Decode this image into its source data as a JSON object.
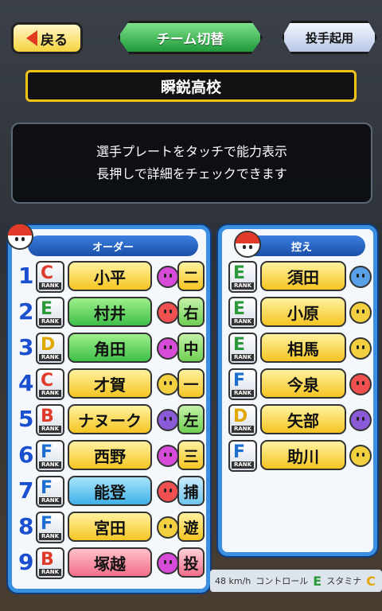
{
  "top_bar": {
    "back_label": "戻る",
    "team_switch_label": "チーム切替",
    "pitcher_label": "投手起用"
  },
  "school_name": "瞬鋭高校",
  "info": {
    "line1": "選手プレートをタッチで能力表示",
    "line2": "長押しで詳細をチェックできます"
  },
  "order_panel": {
    "title": "オーダー",
    "players": [
      {
        "num": "1",
        "rank": "C",
        "name": "小平",
        "pos": "二",
        "mood": "best"
      },
      {
        "num": "2",
        "rank": "E",
        "name": "村井",
        "pos": "右",
        "mood": "good"
      },
      {
        "num": "3",
        "rank": "D",
        "name": "角田",
        "pos": "中",
        "mood": "best"
      },
      {
        "num": "4",
        "rank": "C",
        "name": "才賀",
        "pos": "一",
        "mood": "normal"
      },
      {
        "num": "5",
        "rank": "B",
        "name": "ナヌーク",
        "pos": "左",
        "mood": "bad"
      },
      {
        "num": "6",
        "rank": "F",
        "name": "西野",
        "pos": "三",
        "mood": "best"
      },
      {
        "num": "7",
        "rank": "F",
        "name": "能登",
        "pos": "捕",
        "mood": "good"
      },
      {
        "num": "8",
        "rank": "F",
        "name": "宮田",
        "pos": "遊",
        "mood": "normal"
      },
      {
        "num": "9",
        "rank": "B",
        "name": "塚越",
        "pos": "投",
        "mood": "best"
      }
    ]
  },
  "bench_panel": {
    "title": "控え",
    "players": [
      {
        "rank": "E",
        "name": "須田",
        "mood": "worst"
      },
      {
        "rank": "E",
        "name": "小原",
        "mood": "normal"
      },
      {
        "rank": "E",
        "name": "相馬",
        "mood": "normal"
      },
      {
        "rank": "F",
        "name": "今泉",
        "mood": "good"
      },
      {
        "rank": "D",
        "name": "矢部",
        "mood": "bad"
      },
      {
        "rank": "F",
        "name": "助川",
        "mood": "normal"
      }
    ]
  },
  "rank_text": "RANK",
  "bottom_strip": {
    "speed": "48 km/h",
    "control_label": "コントロール",
    "control_grade": "E",
    "stamina_label": "スタミナ",
    "stamina_grade": "C"
  },
  "colors": {
    "rank": {
      "B": "#e03a2a",
      "C": "#e03a2a",
      "D": "#e0a800",
      "E": "#2a9a3a",
      "F": "#1a6fd0"
    },
    "name_fill": {
      "C": "#ffd84a",
      "E": "#4ecf5a",
      "D": "#4ecf5a",
      "B": "#ffd84a",
      "F": "#ffd84a"
    },
    "mood": {
      "best": "#d84ad8",
      "good": "#f05050",
      "normal": "#f3d040",
      "bad": "#8a5ad8",
      "worst": "#5aa0e8"
    },
    "pos_fill": "#f5d33e",
    "pos_green": "#7bdc62",
    "pos_blue": "#7ec8f0",
    "pos_pink": "#f26e8a"
  }
}
